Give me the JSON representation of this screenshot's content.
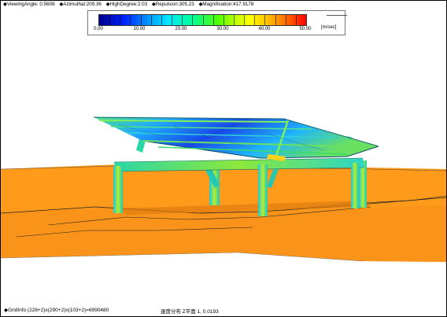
{
  "hud": {
    "viewing_angle": "◆ViewingAngle: 0.5608",
    "azimuthal": "◆Azimuthal:209.36",
    "high_degree": "◆HighDegree:2.03",
    "repulsion": "◆Repulsion:305.23",
    "magnification": "◆Magnification:417.9178"
  },
  "scale": {
    "ticks": [
      "0.00",
      "10.00",
      "20.00",
      "30.00",
      "40.00",
      "50.00"
    ],
    "unit": "[m/sec]"
  },
  "footer": {
    "grid_info": "◆GridInfo (226+2)x(290+2)x(103+2)=6990480",
    "plane_label": "速度分布 Z平面 1, 0.0193"
  },
  "colors": {
    "ground": "#ff9a1a",
    "ground_dark": "#f08a10",
    "frame_green": "#39d96a",
    "panel_blue": "#1f57e0"
  }
}
